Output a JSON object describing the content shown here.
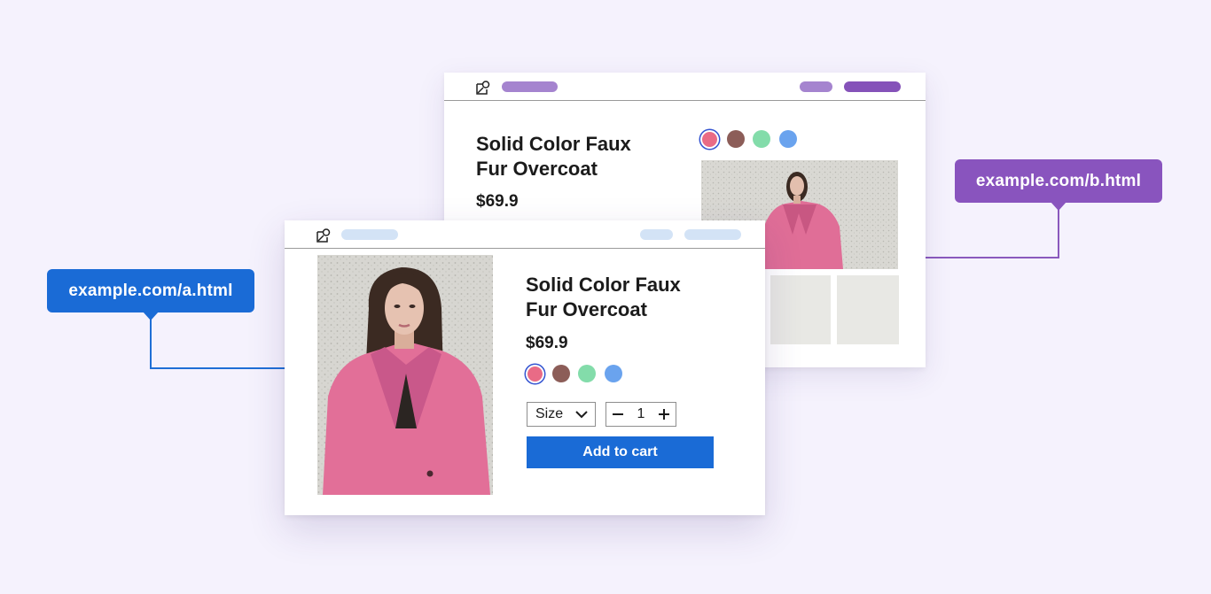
{
  "page_a": {
    "url": "example.com/a.html",
    "product": {
      "title_line1": "Solid Color Faux",
      "title_line2": "Fur Overcoat",
      "price": "$69.9"
    },
    "size_label": "Size",
    "quantity": "1",
    "add_to_cart_label": "Add to cart",
    "nav_color": "#d3e3f6"
  },
  "page_b": {
    "url": "example.com/b.html",
    "product": {
      "title_line1": "Solid Color Faux",
      "title_line2": "Fur Overcoat",
      "price": "$69.9"
    },
    "nav_color": "#a584cf",
    "nav_active_color": "#8552b9"
  },
  "swatch_colors": [
    "#e96b86",
    "#8c5d58",
    "#83dcaa",
    "#6aa3ee"
  ],
  "accent_blue": "#1a6bd6",
  "accent_purple": "#8954be",
  "icons": [
    "logo-icon",
    "chevron-down-icon",
    "minus-icon",
    "plus-icon"
  ]
}
